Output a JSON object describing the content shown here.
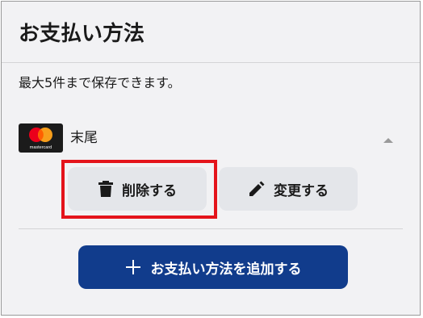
{
  "page": {
    "title": "お支払い方法",
    "description": "最大5件まで保存できます。"
  },
  "card": {
    "brand_logo_text": "mastercard",
    "name": "末尾",
    "collapse_icon": "chevron-up-icon"
  },
  "actions": {
    "delete_label": "削除する",
    "delete_icon": "trash-icon",
    "edit_label": "変更する",
    "edit_icon": "pencil-icon",
    "add_label": "お支払い方法を追加する",
    "add_icon": "plus-icon"
  },
  "colors": {
    "primary": "#113c8c",
    "secondary_button": "#e4e6ea",
    "highlight": "#e4141b",
    "mastercard_red": "#eb001b",
    "mastercard_orange": "#f79e1b"
  }
}
